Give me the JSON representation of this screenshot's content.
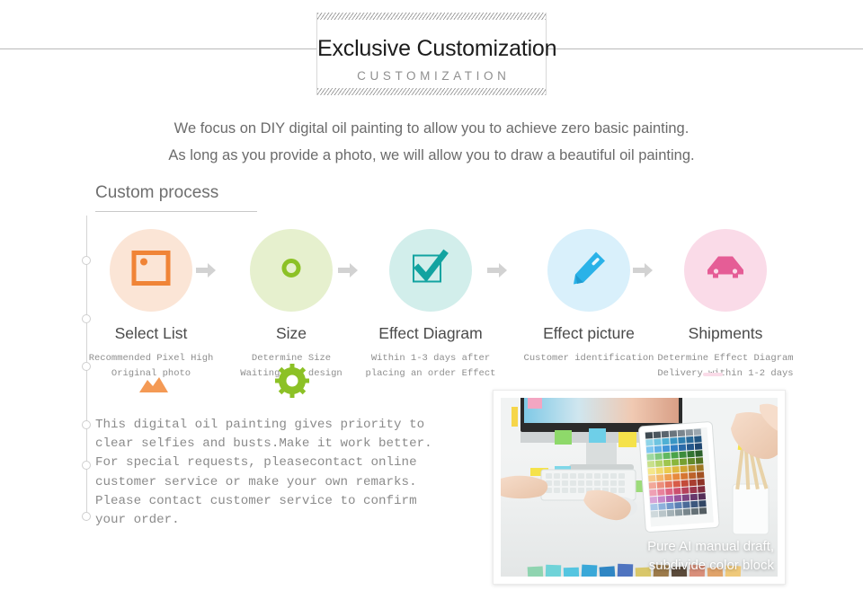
{
  "header": {
    "title": "Exclusive Customization",
    "subtitle": "CUSTOMIZATION"
  },
  "intro": {
    "line1": "We focus on DIY digital oil painting to allow you to achieve zero basic painting.",
    "line2": "As long as you provide a photo, we will allow you to draw a beautiful oil painting."
  },
  "section": {
    "heading": "Custom process"
  },
  "steps": [
    {
      "title": "Select List",
      "sub1": "Recommended Pixel High",
      "sub2": "Original photo",
      "icon": "photo-frame-icon",
      "circle_color": "#fbe5d6",
      "icon_color": "#f08437"
    },
    {
      "title": "Size",
      "sub1": "Determine Size",
      "sub2": "Waiting for design",
      "icon": "ruler-dot-icon",
      "circle_color": "#e6f0ce",
      "icon_color": "#8cc126"
    },
    {
      "title": "Effect Diagram",
      "sub1": "Within 1-3 days after",
      "sub2": "placing an order Effect",
      "icon": "checkbox-check-icon",
      "circle_color": "#d2eeeb",
      "icon_color": "#12a3a0"
    },
    {
      "title": "Effect picture",
      "sub1": "Customer identification",
      "sub2": "",
      "icon": "pencil-icon",
      "circle_color": "#d9f0fb",
      "icon_color": "#2ab2e8"
    },
    {
      "title": "Shipments",
      "sub1": "Determine Effect Diagram",
      "sub2": "Delivery within 1-2 days",
      "icon": "delivery-car-icon",
      "circle_color": "#fadbe8",
      "icon_color": "#e55d96"
    }
  ],
  "decor": {
    "mountain_color": "#f49a55",
    "gear_color": "#8cc126"
  },
  "body": {
    "line1": "This digital oil painting gives priority to",
    "line2": "clear selfies and busts.Make it work better.",
    "line3": "For special requests, pleasecontact online",
    "line4": "customer service or make your own remarks.",
    "line5": "Please contact customer service to confirm",
    "line6": "your order."
  },
  "photo": {
    "caption_line1": "Pure AI manual draft,",
    "caption_line2": "subdivide color block",
    "alt": "designer-desk-workspace-photo"
  },
  "colors": {
    "rule": "#b9b9b9",
    "text_muted": "#8b8b8b",
    "arrow": "#d2d2d2"
  }
}
